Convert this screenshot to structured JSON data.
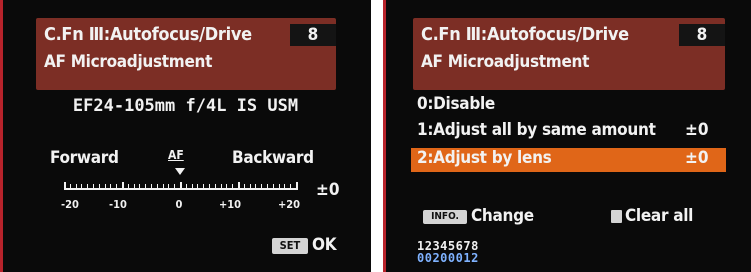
{
  "left_screen": {
    "header": {
      "title": "C.Fn Ⅲ:Autofocus/Drive",
      "subtitle": "AF Microadjustment",
      "page": "8"
    },
    "lens": "EF24-105mm f/4L IS USM",
    "direction": {
      "forward": "Forward",
      "backward": "Backward"
    },
    "af_mark": "AF",
    "scale": {
      "ticks": [
        "-20",
        "-10",
        "0",
        "+10",
        "+20"
      ],
      "current_fraction": 0.5
    },
    "value": "±0",
    "set_button": {
      "chip": "SET",
      "label": "OK"
    }
  },
  "right_screen": {
    "header": {
      "title": "C.Fn Ⅲ:Autofocus/Drive",
      "subtitle": "AF Microadjustment",
      "page": "8"
    },
    "options": [
      {
        "label": "0:Disable",
        "value": ""
      },
      {
        "label": "1:Adjust all by same amount",
        "value": "±0"
      },
      {
        "label": "2:Adjust by lens",
        "value": "±0"
      }
    ],
    "selected_index": 2,
    "info_button": {
      "chip": "INFO.",
      "label": "Change"
    },
    "clear_button": {
      "label": "Clear all"
    },
    "settings_row": {
      "numbers": "12345678",
      "values": "00200012"
    }
  },
  "colors": {
    "header": "#7c2e25",
    "selected": "#e06618",
    "background": "#0a0a0a"
  }
}
